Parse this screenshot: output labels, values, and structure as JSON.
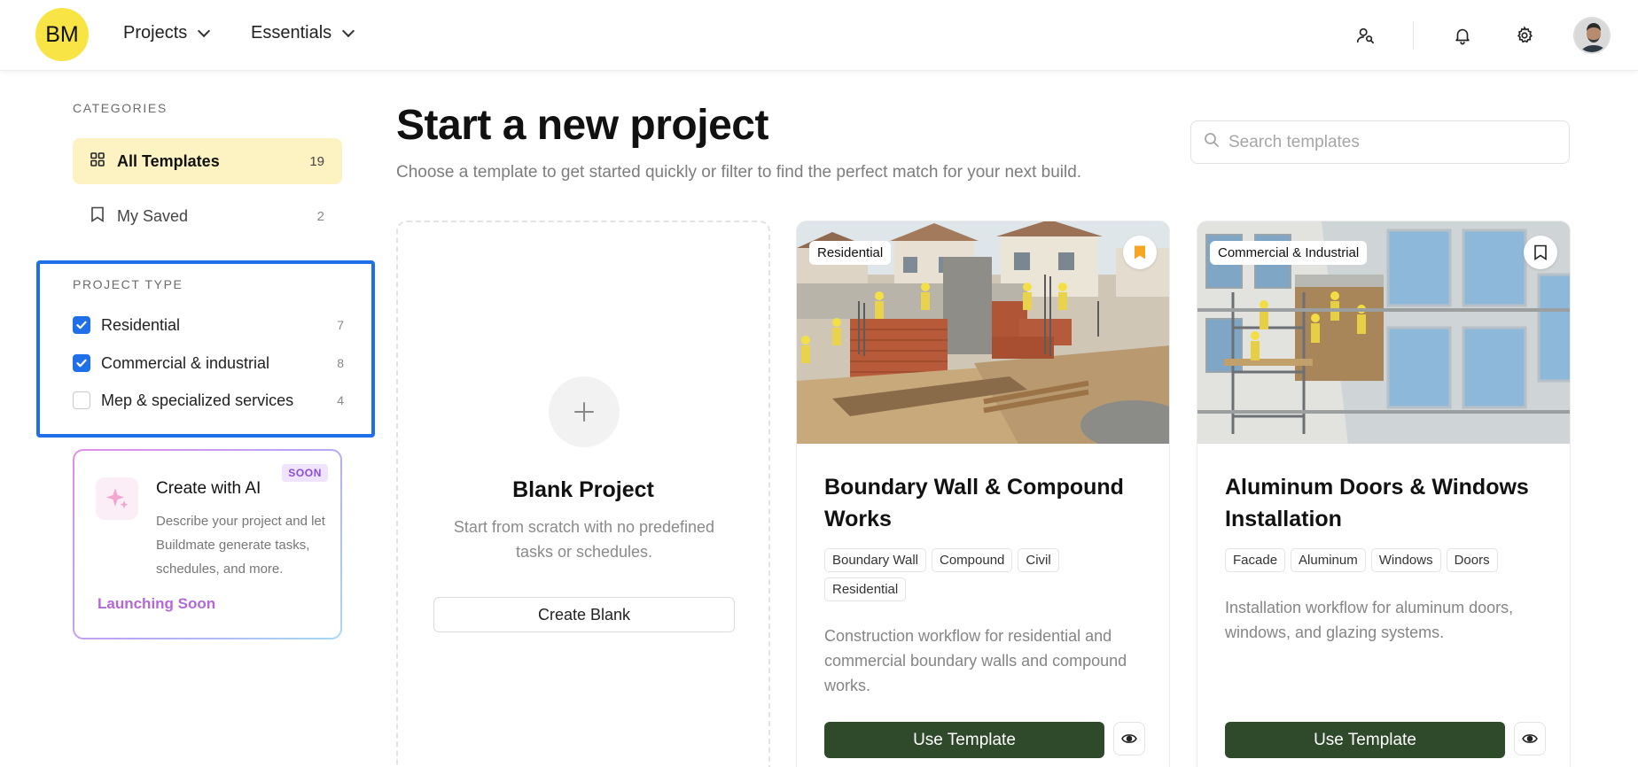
{
  "header": {
    "logo_text": "BM",
    "nav": [
      {
        "label": "Projects"
      },
      {
        "label": "Essentials"
      }
    ],
    "icons": [
      "user-search-icon",
      "bell-icon",
      "gear-icon",
      "avatar"
    ]
  },
  "sidebar": {
    "categories_title": "CATEGORIES",
    "categories": [
      {
        "label": "All Templates",
        "count": "19",
        "active": true,
        "icon": "grid-icon"
      },
      {
        "label": "My Saved",
        "count": "2",
        "active": false,
        "icon": "bookmark-icon"
      }
    ],
    "project_type_title": "PROJECT TYPE",
    "project_types": [
      {
        "label": "Residential",
        "count": "7",
        "checked": true
      },
      {
        "label": "Commercial & industrial",
        "count": "8",
        "checked": true
      },
      {
        "label": "Mep & specialized services",
        "count": "4",
        "checked": false
      }
    ],
    "ai_card": {
      "title": "Create with AI",
      "badge": "SOON",
      "description": "Describe your project and let Buildmate generate tasks, schedules, and more.",
      "footer": "Launching Soon"
    }
  },
  "main": {
    "title": "Start a new project",
    "subtitle": "Choose a template to get started quickly or filter to find the perfect match for your next build.",
    "search_placeholder": "Search templates",
    "blank_card": {
      "title": "Blank Project",
      "description": "Start from scratch with no predefined tasks or schedules.",
      "button": "Create Blank"
    },
    "templates": [
      {
        "category": "Residential",
        "title": "Boundary Wall & Compound Works",
        "tags": [
          "Boundary Wall",
          "Compound",
          "Civil",
          "Residential"
        ],
        "description": "Construction workflow for residential and commercial boundary walls and compound works.",
        "button": "Use Template",
        "saved": true
      },
      {
        "category": "Commercial & Industrial",
        "title": "Aluminum Doors & Windows Installation",
        "tags": [
          "Facade",
          "Aluminum",
          "Windows",
          "Doors"
        ],
        "description": "Installation workflow for aluminum doors, windows, and glazing systems.",
        "button": "Use Template",
        "saved": false
      }
    ]
  },
  "colors": {
    "accent_yellow": "#f8e545",
    "active_bg": "#fdf3c2",
    "checkbox_blue": "#1f6fe8",
    "primary_button": "#2f4a2b",
    "ai_purple": "#b468d8",
    "bookmark_orange": "#f5a623"
  }
}
